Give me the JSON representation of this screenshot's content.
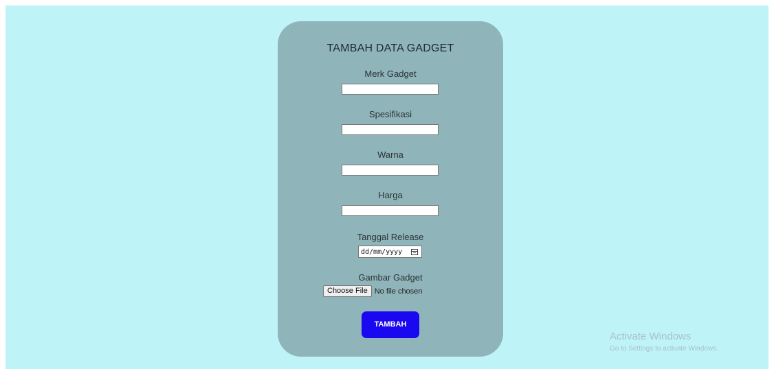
{
  "form": {
    "title": "TAMBAH DATA GADGET",
    "fields": [
      {
        "label": "Merk Gadget",
        "value": ""
      },
      {
        "label": "Spesifikasi",
        "value": ""
      },
      {
        "label": "Warna",
        "value": ""
      },
      {
        "label": "Harga",
        "value": ""
      }
    ],
    "release_date": {
      "label": "Tanggal Release",
      "placeholder": "dd/mm/yyyy"
    },
    "image": {
      "label": "Gambar Gadget",
      "button_label": "Choose File",
      "status": "No file chosen"
    },
    "submit_label": "TAMBAH"
  },
  "watermark": {
    "title": "Activate Windows",
    "subtitle": "Go to Settings to activate Windows."
  },
  "colors": {
    "page_background": "#bef3f8",
    "card_background": "#8fb4b9",
    "submit_button": "#1a08f0"
  }
}
